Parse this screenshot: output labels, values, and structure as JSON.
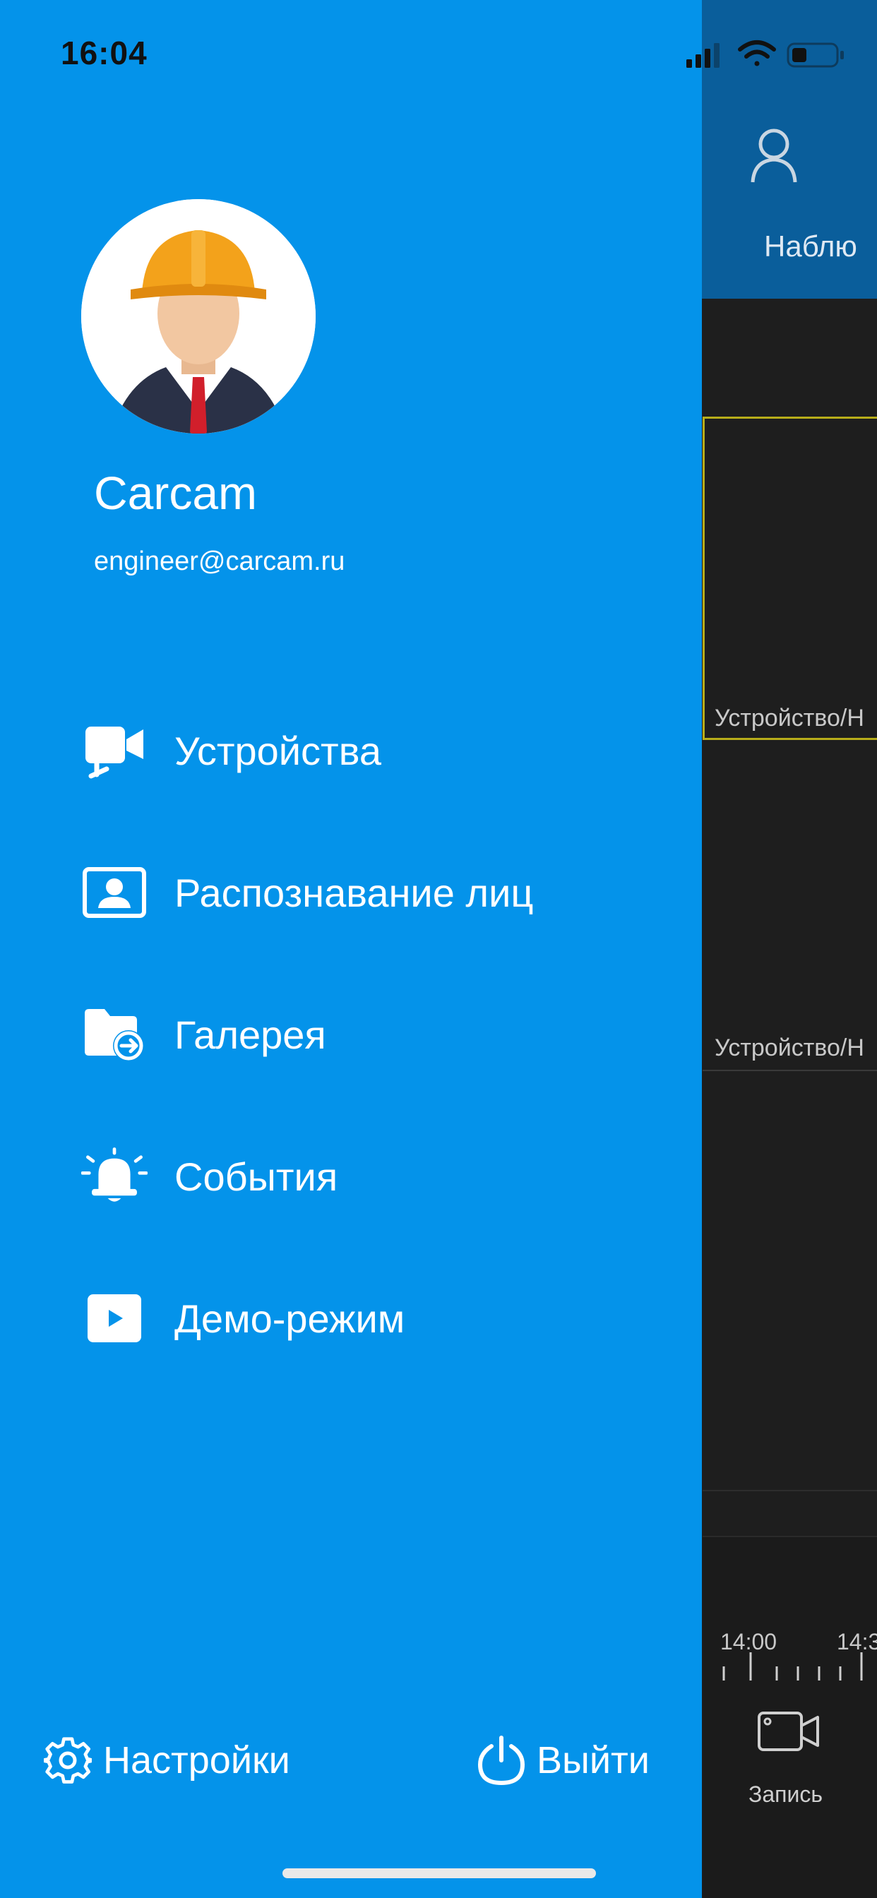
{
  "status_bar": {
    "time": "16:04"
  },
  "profile": {
    "name": "Carcam",
    "email": "engineer@carcam.ru"
  },
  "menu": [
    {
      "label": "Устройства",
      "icon": "video-camera-icon"
    },
    {
      "label": "Распознавание лиц",
      "icon": "face-id-card-icon"
    },
    {
      "label": "Галерея",
      "icon": "folder-arrow-icon"
    },
    {
      "label": "События",
      "icon": "bell-alarm-icon"
    },
    {
      "label": "Демо-режим",
      "icon": "play-icon"
    }
  ],
  "footer": {
    "settings_label": "Настройки",
    "logout_label": "Выйти"
  },
  "background": {
    "title": "Наблю",
    "tile_labels": [
      "Устройство/Н",
      "Устройство/Н"
    ],
    "timeline_labels": [
      "14:00",
      "14:3"
    ],
    "record_label": "Запись"
  },
  "colors": {
    "drawer": "#0493ea",
    "header": "#0a5e9b",
    "dark_bg": "#1e1e1e",
    "tile_border": "#b7ad1a"
  }
}
